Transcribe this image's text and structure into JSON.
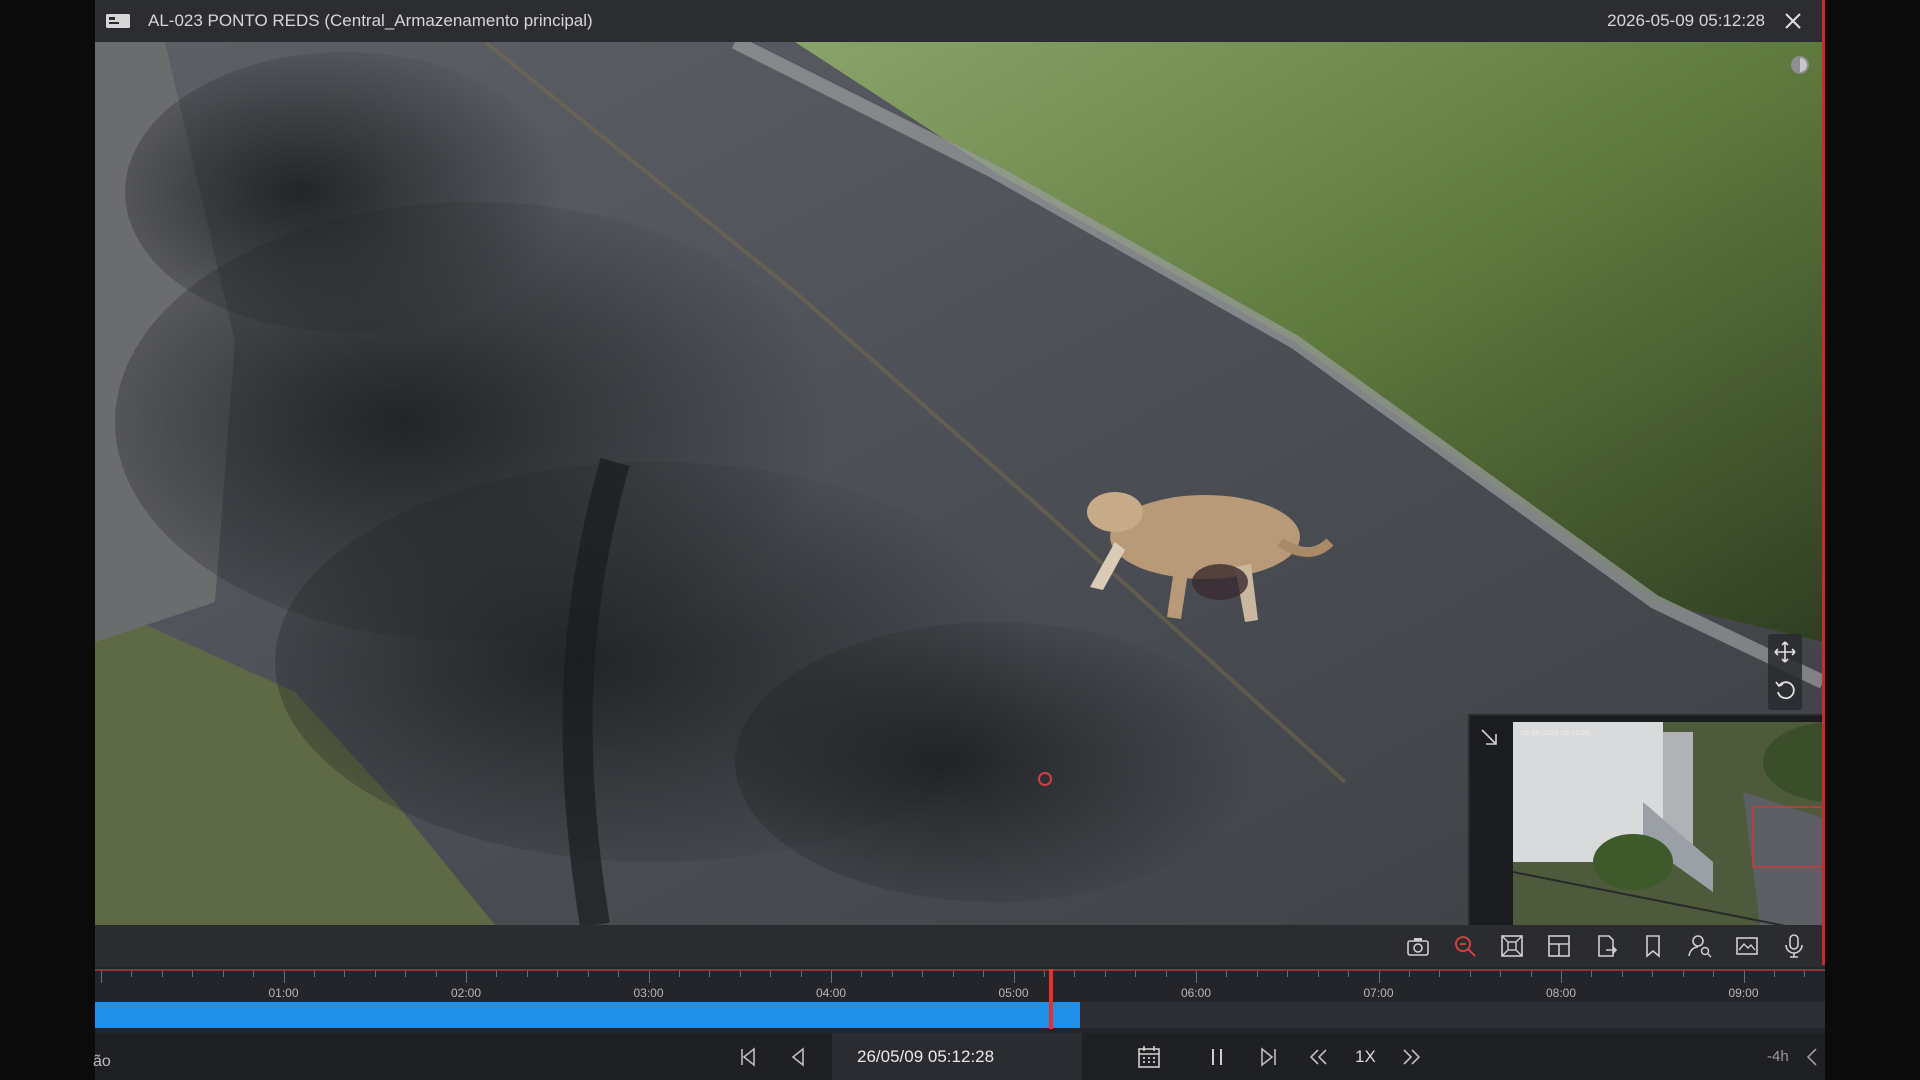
{
  "window": {
    "title": "AL-023 PONTO REDS (Central_Armazenamento principal)",
    "clock": "2026-05-09 05:12:28",
    "accent": "#d3262c"
  },
  "video": {
    "pip_timestamp": "05-05-2026 05:12:28"
  },
  "toolbar": {
    "tools": [
      "camera-icon",
      "digital-zoom-icon",
      "fisheye-icon",
      "layout-icon",
      "export-clip-icon",
      "bookmark-icon",
      "person-search-icon",
      "image-adjust-icon",
      "microphone-icon"
    ]
  },
  "timeline": {
    "labels": [
      "01:00",
      "02:00",
      "03:00",
      "04:00",
      "05:00",
      "06:00",
      "07:00",
      "08:00",
      "09:00"
    ],
    "recorded_until": "05:22",
    "current": "05:12:28",
    "recorded_color": "#1e90e8"
  },
  "controls": {
    "side_label": "ão",
    "datetime": "26/05/09 05:12:28",
    "speed": "1X",
    "range": "-4h"
  }
}
